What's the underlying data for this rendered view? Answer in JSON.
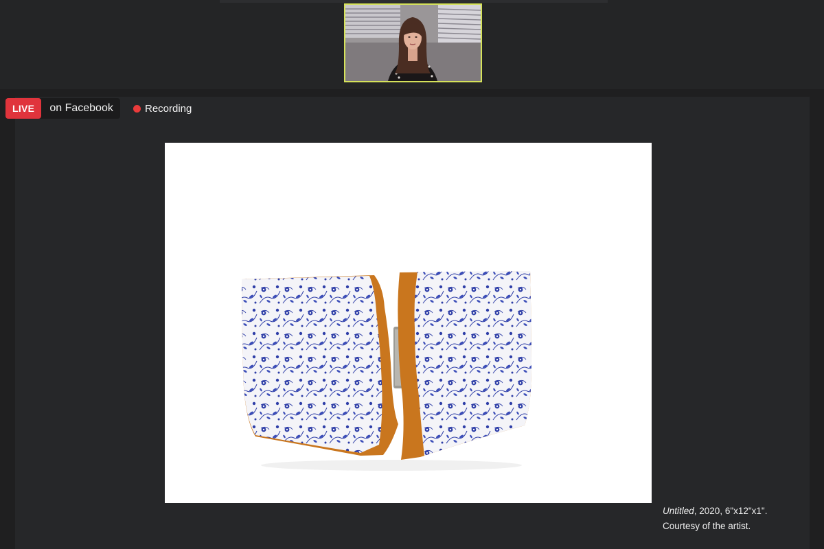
{
  "stream": {
    "live_label": "LIVE",
    "platform_text": "on Facebook",
    "recording_label": "Recording"
  },
  "speaker_video": {
    "description_icon": "person-video-icon"
  },
  "slide": {
    "artwork_title": "Untitled",
    "artwork_details": ", 2020, 6\"x12\"x1\".",
    "credit": "Courtesy of the artist."
  },
  "colors": {
    "live_red": "#e0343c",
    "recording_dot": "#ea3b3b",
    "active_speaker_border": "#d6e35a",
    "porcelain_blue": "#2f3fa8",
    "crust_orange": "#c9761e"
  }
}
